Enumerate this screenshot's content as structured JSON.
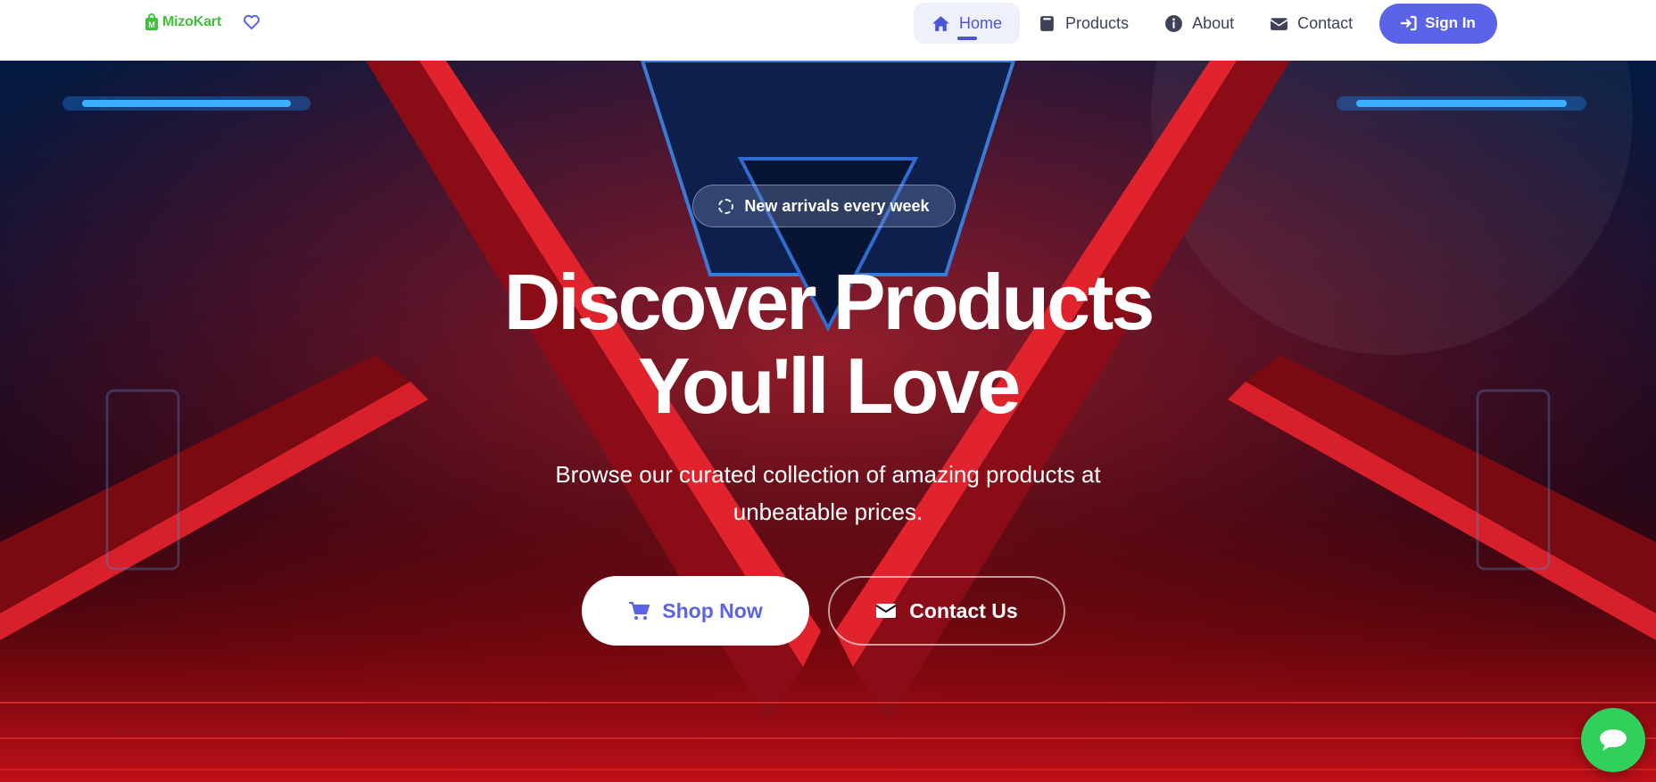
{
  "brand": {
    "name": "MizoKart",
    "logo_icon": "shopping-bag-icon",
    "wishlist_icon": "heart-icon"
  },
  "nav": {
    "items": [
      {
        "label": "Home",
        "icon": "home-icon",
        "active": true
      },
      {
        "label": "Products",
        "icon": "box-icon",
        "active": false
      },
      {
        "label": "About",
        "icon": "info-icon",
        "active": false
      },
      {
        "label": "Contact",
        "icon": "envelope-icon",
        "active": false
      }
    ],
    "signin_label": "Sign In",
    "signin_icon": "sign-in-icon"
  },
  "hero": {
    "badge": "New arrivals every week",
    "title_line1": "Discover Products",
    "title_line2": "You'll Love",
    "subtitle": "Browse our curated collection of amazing products at unbeatable prices.",
    "shop_label": "Shop Now",
    "shop_icon": "cart-icon",
    "contact_label": "Contact Us",
    "contact_icon": "envelope-icon"
  },
  "chat_icon": "chat-bubble-icon",
  "colors": {
    "accent": "#5b63e8",
    "brand_green": "#3fbf3a",
    "chat_green": "#2fd15a",
    "nav_active_bg": "#eef0fc"
  }
}
